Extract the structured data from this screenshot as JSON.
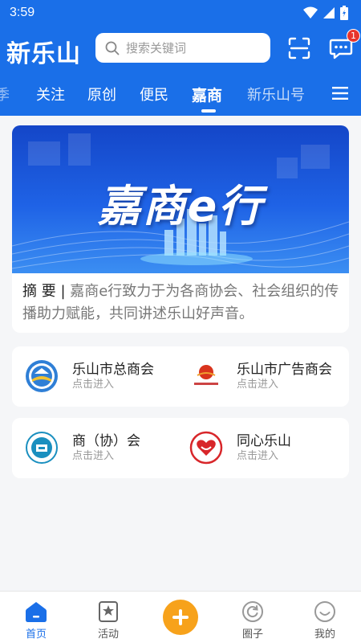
{
  "status_bar": {
    "time": "3:59"
  },
  "header": {
    "logo": "新乐山",
    "search_placeholder": "搜索关键词",
    "message_count": "1"
  },
  "tabs": [
    {
      "label": "季"
    },
    {
      "label": "关注"
    },
    {
      "label": "原创"
    },
    {
      "label": "便民"
    },
    {
      "label": "嘉商",
      "active": true
    },
    {
      "label": "新乐山号"
    }
  ],
  "banner": {
    "title": "嘉商e行",
    "summary_label": "摘 要 |",
    "summary_text": " 嘉商e行致力于为各商协会、社会组织的传播助力赋能，共同讲述乐山好声音。"
  },
  "entries": [
    {
      "name": "乐山市总商会",
      "sub": "点击进入",
      "icon": "chamber-of-commerce-logo"
    },
    {
      "name": "乐山市广告商会",
      "sub": "点击进入",
      "icon": "advertising-chamber-logo"
    },
    {
      "name": "商（协）会",
      "sub": "点击进入",
      "icon": "association-logo"
    },
    {
      "name": "同心乐山",
      "sub": "点击进入",
      "icon": "tongxin-logo"
    }
  ],
  "bottom_nav": [
    {
      "label": "首页",
      "icon": "home-icon",
      "active": true
    },
    {
      "label": "活动",
      "icon": "star-card-icon"
    },
    {
      "label": "",
      "icon": "plus-icon"
    },
    {
      "label": "圈子",
      "icon": "refresh-circle-icon"
    },
    {
      "label": "我的",
      "icon": "smile-icon"
    }
  ],
  "colors": {
    "primary": "#1a6fe8",
    "accent": "#f7a21b",
    "badge": "#e8342c"
  }
}
